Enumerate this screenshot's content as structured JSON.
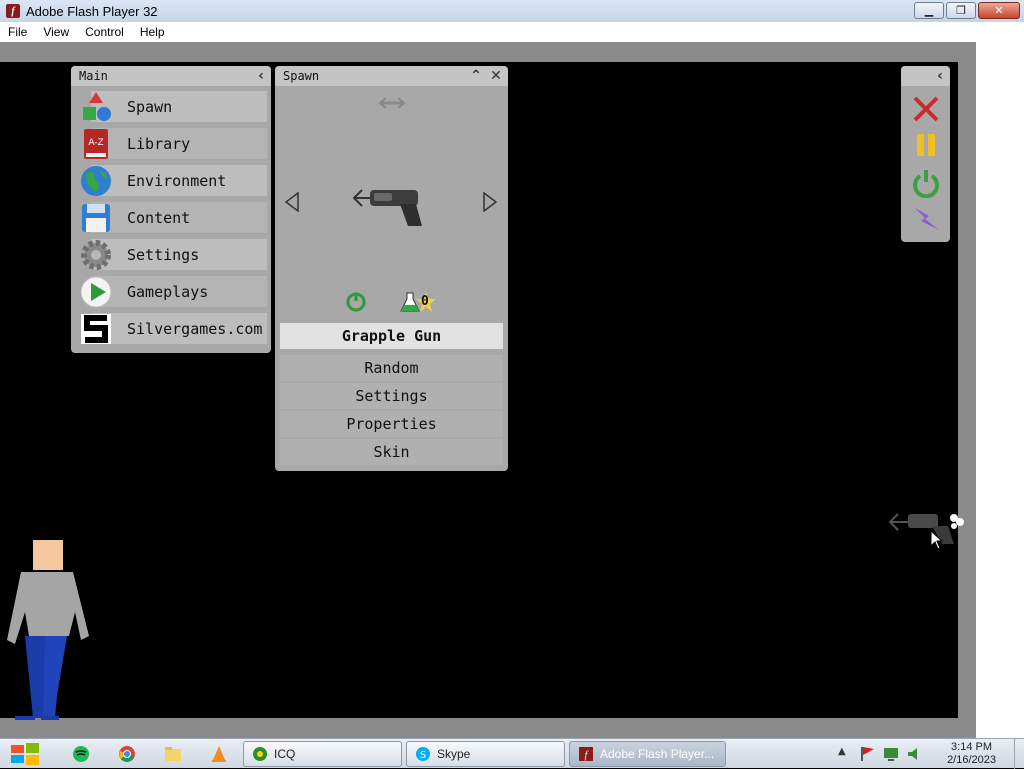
{
  "window": {
    "title": "Adobe Flash Player 32",
    "buttons": {
      "minimize": "▁",
      "maximize": "❐",
      "close": "✕"
    }
  },
  "menubar": [
    "File",
    "View",
    "Control",
    "Help"
  ],
  "main_panel": {
    "title": "Main",
    "items": [
      {
        "label": "Spawn",
        "icon": "shapes-icon"
      },
      {
        "label": "Library",
        "icon": "book-az-icon"
      },
      {
        "label": "Environment",
        "icon": "globe-icon"
      },
      {
        "label": "Content",
        "icon": "floppy-disk-icon"
      },
      {
        "label": "Settings",
        "icon": "gear-icon"
      },
      {
        "label": "Gameplays",
        "icon": "play-icon"
      },
      {
        "label": "Silvergames.com",
        "icon": "silvergames-logo-icon"
      }
    ]
  },
  "spawn_panel": {
    "title": "Spawn",
    "selected_item": "Grapple Gun",
    "counter": "0",
    "options": [
      "Random",
      "Settings",
      "Properties",
      "Skin"
    ]
  },
  "controls": [
    "close-x-icon",
    "pause-icon",
    "power-icon",
    "lightning-icon"
  ],
  "taskbar": {
    "tasks": [
      {
        "label": "ICQ"
      },
      {
        "label": "Skype"
      },
      {
        "label": "Adobe Flash Player..."
      }
    ],
    "time": "3:14 PM",
    "date": "2/16/2023"
  },
  "colors": {
    "accent_red": "#cc2a2a",
    "pause_yellow": "#f0c020",
    "power_green": "#3aa040",
    "lightning_purple": "#8a5ad8"
  }
}
